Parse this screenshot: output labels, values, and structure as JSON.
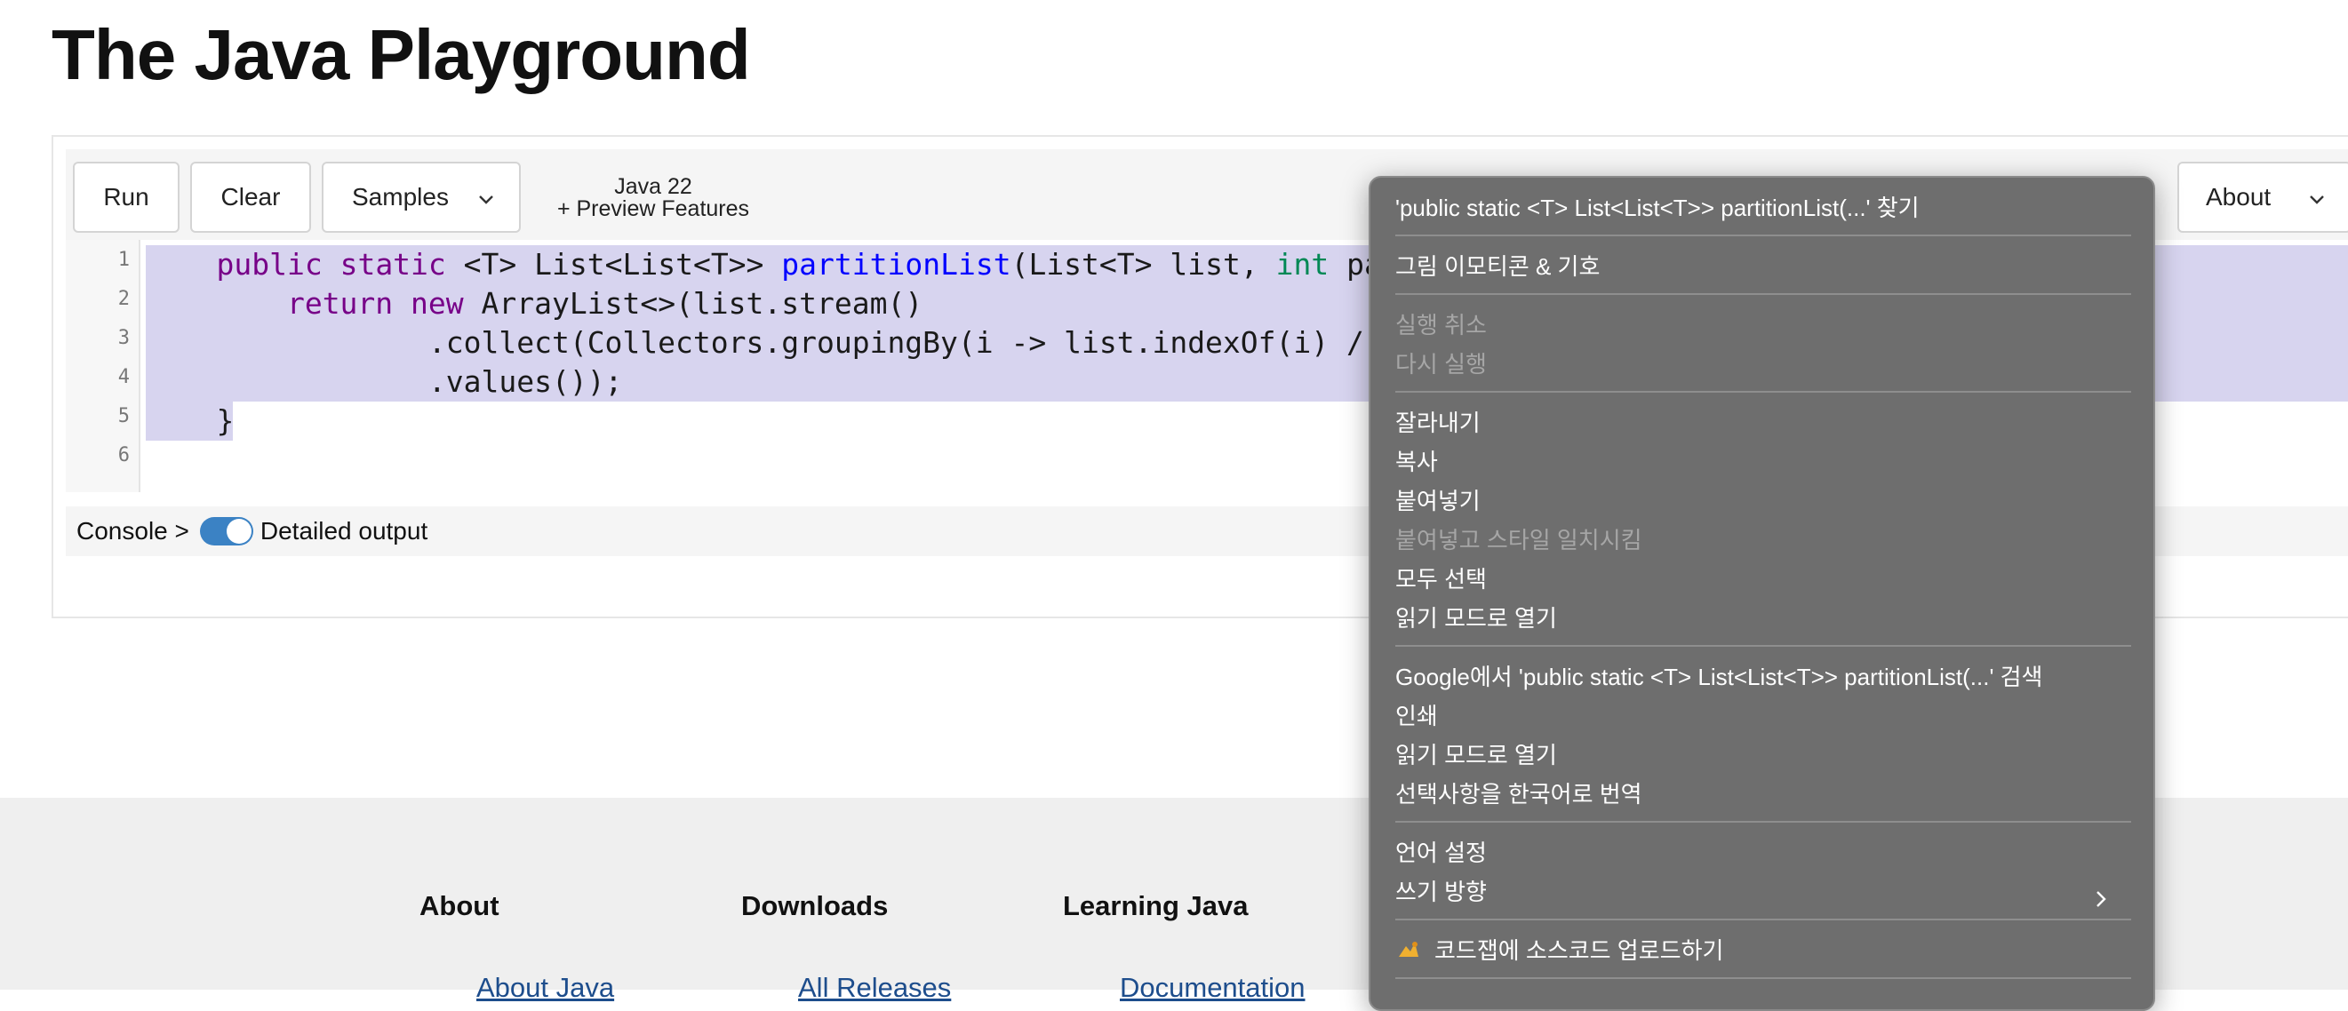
{
  "page": {
    "title": "The Java Playground"
  },
  "toolbar": {
    "run_label": "Run",
    "clear_label": "Clear",
    "samples_label": "Samples",
    "version_line1": "Java 22",
    "version_line2": "+ Preview Features",
    "about_label": "About"
  },
  "editor": {
    "line_numbers": [
      "1",
      "2",
      "3",
      "4",
      "5",
      "6"
    ],
    "code": {
      "l1_indent": "    ",
      "l1_public": "public",
      "l1_static": "static",
      "l1_a": "<T> List<List<T>> ",
      "l1_fn": "partitionList",
      "l1_b": "(List<T> list, ",
      "l1_int": "int",
      "l1_c": " part",
      "l2_indent": "        ",
      "l2_return": "return",
      "l2_new": "new",
      "l2_rest": " ArrayList<>(list.stream()",
      "l3": "                .collect(Collectors.groupingBy(i -> list.indexOf(i) / pa",
      "l4": "                .values());",
      "l5": "    }"
    }
  },
  "console": {
    "label": "Console >",
    "detailed_output_label": "Detailed output",
    "detailed_output_on": true
  },
  "footer": {
    "columns": [
      "About",
      "Downloads",
      "Learning Java"
    ],
    "links": [
      "About Java",
      "All Releases",
      "Documentation"
    ]
  },
  "context_menu": {
    "items": [
      {
        "label": "'public static <T> List<List<T>> partitionList(...' 찾기",
        "enabled": true
      },
      {
        "label": "그림 이모티콘 & 기호",
        "enabled": true
      },
      {
        "label": "실행 취소",
        "enabled": false
      },
      {
        "label": "다시 실행",
        "enabled": false
      },
      {
        "label": "잘라내기",
        "enabled": true
      },
      {
        "label": "복사",
        "enabled": true
      },
      {
        "label": "붙여넣기",
        "enabled": true
      },
      {
        "label": "붙여넣고 스타일 일치시킴",
        "enabled": false
      },
      {
        "label": "모두 선택",
        "enabled": true
      },
      {
        "label": "읽기 모드로 열기",
        "enabled": true
      },
      {
        "label": "Google에서 'public static <T> List<List<T>> partitionList(...' 검색",
        "enabled": true
      },
      {
        "label": "인쇄",
        "enabled": true
      },
      {
        "label": "읽기 모드로 열기",
        "enabled": true
      },
      {
        "label": "선택사항을 한국어로 번역",
        "enabled": true
      },
      {
        "label": "언어 설정",
        "enabled": true
      },
      {
        "label": "쓰기 방향",
        "enabled": true
      },
      {
        "label": "코드잽에 소스코드 업로드하기",
        "enabled": true,
        "icon": "extension-icon"
      }
    ]
  },
  "colors": {
    "selection": "#d7d4ef",
    "keyword": "#770088",
    "function": "#0000ff",
    "type": "#008855",
    "toggle_on": "#3b82c4",
    "menu_bg": "#6e6e6e"
  }
}
